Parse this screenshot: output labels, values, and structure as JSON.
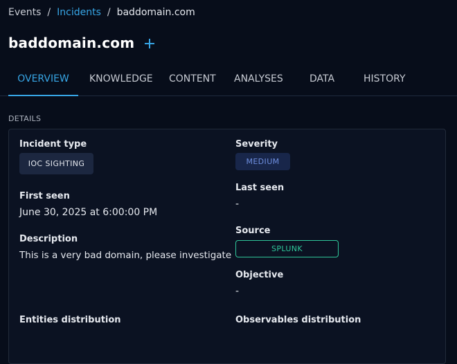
{
  "breadcrumb": {
    "events": "Events",
    "incidents": "Incidents",
    "current": "baddomain.com",
    "separator": "/"
  },
  "header": {
    "title": "baddomain.com"
  },
  "tabs": [
    {
      "label": "OVERVIEW",
      "active": true
    },
    {
      "label": "KNOWLEDGE",
      "active": false
    },
    {
      "label": "CONTENT",
      "active": false
    },
    {
      "label": "ANALYSES",
      "active": false
    },
    {
      "label": "DATA",
      "active": false
    },
    {
      "label": "HISTORY",
      "active": false
    }
  ],
  "details": {
    "section_label": "DETAILS",
    "incident_type": {
      "label": "Incident type",
      "value": "IOC SIGHTING"
    },
    "first_seen": {
      "label": "First seen",
      "value": "June 30, 2025 at 6:00:00 PM"
    },
    "description": {
      "label": "Description",
      "value": "This is a very bad domain, please investigate"
    },
    "entities_distribution": {
      "label": "Entities distribution"
    },
    "severity": {
      "label": "Severity",
      "value": "MEDIUM"
    },
    "last_seen": {
      "label": "Last seen",
      "value": "-"
    },
    "source": {
      "label": "Source",
      "value": "SPLUNK"
    },
    "objective": {
      "label": "Objective",
      "value": "-"
    },
    "observables_distribution": {
      "label": "Observables distribution"
    }
  },
  "colors": {
    "background": "#070d1a",
    "accent": "#37a6e6",
    "severity_medium": "#6f8fe0",
    "source_green": "#2fc79a"
  },
  "icons": {
    "add": "plus-icon"
  }
}
